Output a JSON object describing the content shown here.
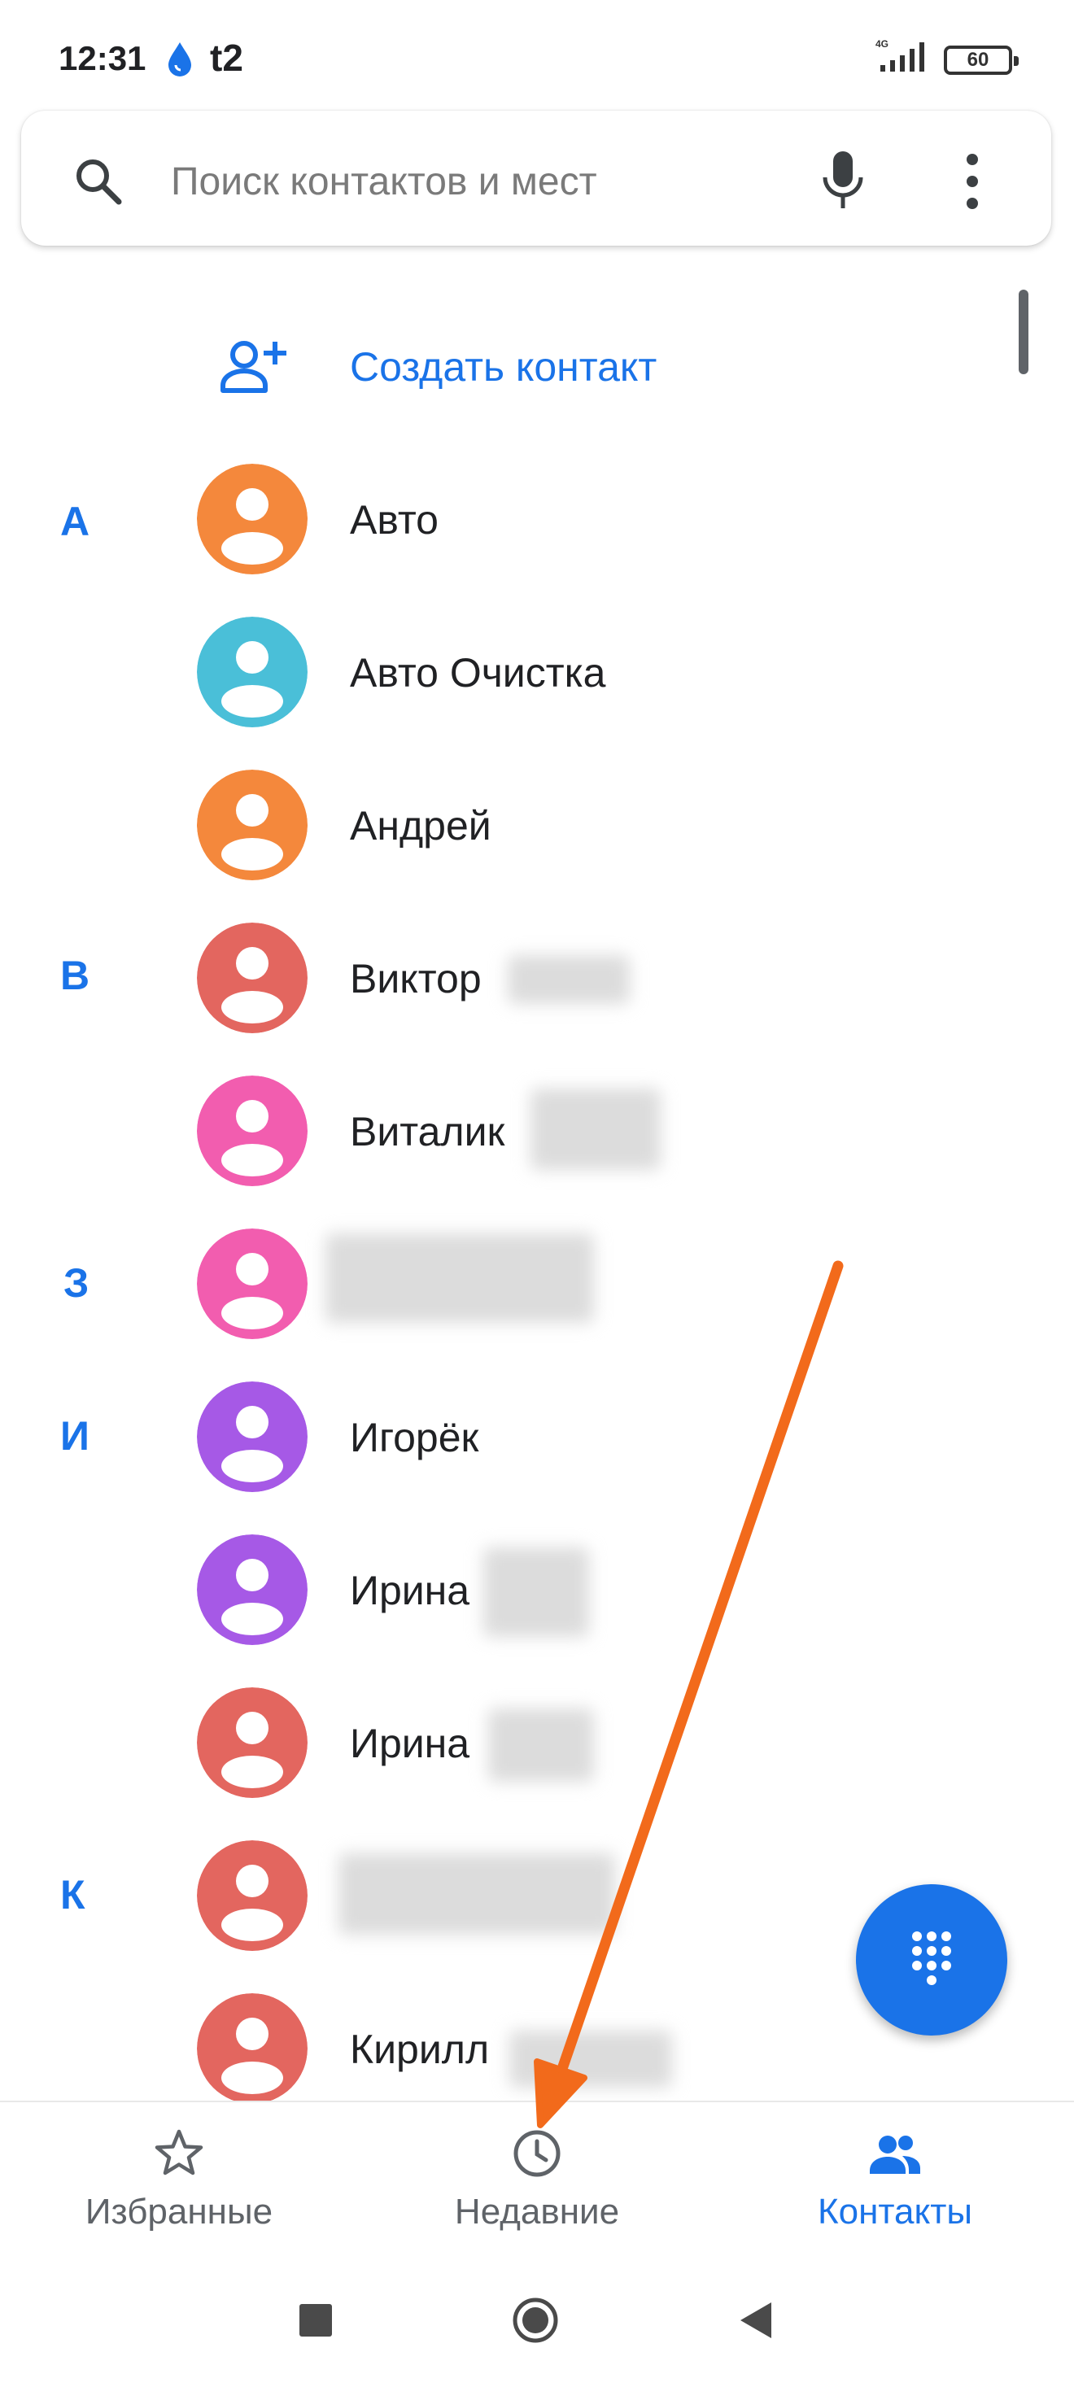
{
  "status_bar": {
    "time": "12:31",
    "carrier": "t2",
    "signal_label": "4G",
    "battery": "60"
  },
  "search": {
    "placeholder": "Поиск контактов и мест"
  },
  "create_contact": {
    "label": "Создать контакт"
  },
  "sections": [
    {
      "letter": "А"
    },
    {
      "letter": "В"
    },
    {
      "letter": "З"
    },
    {
      "letter": "И"
    },
    {
      "letter": "К"
    }
  ],
  "contacts": [
    {
      "name": "Авто",
      "color": "#F4883C"
    },
    {
      "name": "Авто Очистка",
      "color": "#4ABFD8"
    },
    {
      "name": "Андрей",
      "color": "#F4883C"
    },
    {
      "name": "Виктор",
      "color": "#E3665F"
    },
    {
      "name": "Виталик",
      "color": "#F25DAF"
    },
    {
      "name": "",
      "color": "#F25DAF"
    },
    {
      "name": "Игорёк",
      "color": "#A659E6"
    },
    {
      "name": "Ирина",
      "color": "#A659E6"
    },
    {
      "name": "Ирина",
      "color": "#E3665F"
    },
    {
      "name": "",
      "color": "#E3665F"
    },
    {
      "name": "Кирилл",
      "color": "#E3665F"
    }
  ],
  "bottom_nav": [
    {
      "label": "Избранные",
      "icon": "star-icon",
      "active": false
    },
    {
      "label": "Недавние",
      "icon": "clock-icon",
      "active": false
    },
    {
      "label": "Контакты",
      "icon": "people-icon",
      "active": true
    }
  ],
  "colors": {
    "accent": "#1a73e8",
    "annotation_arrow": "#F26A1B"
  }
}
